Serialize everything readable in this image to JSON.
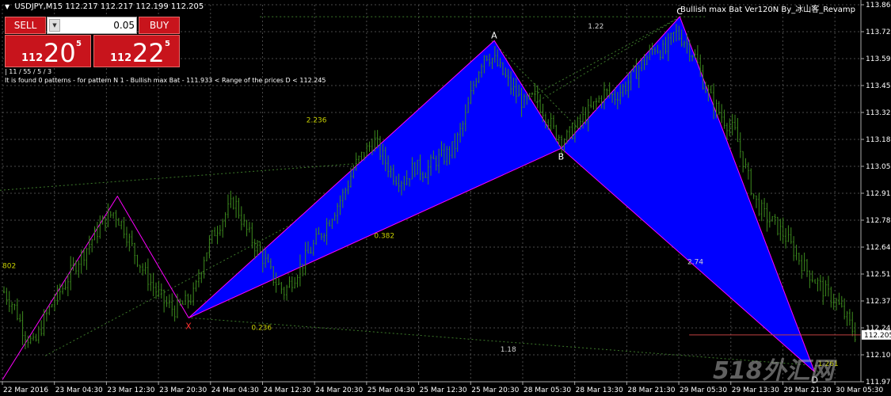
{
  "header": {
    "symbol": "USDJPY,M15",
    "ohlc": "112.217 112.217 112.199 112.205",
    "ea_title": "Bullish max Bat Ver120N By_冰山客_Revamp"
  },
  "trade_panel": {
    "sell_label": "SELL",
    "buy_label": "BUY",
    "lot_value": "0.05",
    "bid_small": "112",
    "bid_big": "20",
    "bid_sup": "5",
    "ask_small": "112",
    "ask_big": "22",
    "ask_sup": "5"
  },
  "info_lines": {
    "line1": "| 11 / 55 / 5 / 3",
    "line2": "It is found 0 patterns  -  for pattern N 1 - Bullish max Bat - 111.933 < Range of the prices D < 112.245"
  },
  "colors": {
    "background": "#000000",
    "grid": "#4a4a4a",
    "candles": "#3d8b1e",
    "pattern_fill": "#0000ff",
    "pattern_edge": "#ff00ff",
    "fib_text": "#c8d000",
    "panel_red": "#c8141c",
    "price_tag": "#ffffff"
  },
  "chart_data": {
    "type": "candlestick",
    "symbol": "USDJPY",
    "timeframe": "M15",
    "ylim": [
      111.97,
      113.86
    ],
    "y_ticks": [
      "113.860",
      "113.725",
      "113.590",
      "113.455",
      "113.320",
      "113.185",
      "113.050",
      "112.915",
      "112.780",
      "112.645",
      "112.510",
      "112.375",
      "112.240",
      "112.105",
      "111.970"
    ],
    "current_price": "112.205",
    "x_ticks": [
      "22 Mar 2016",
      "23 Mar 04:30",
      "23 Mar 12:30",
      "23 Mar 20:30",
      "24 Mar 04:30",
      "24 Mar 12:30",
      "24 Mar 20:30",
      "25 Mar 04:30",
      "25 Mar 12:30",
      "25 Mar 20:30",
      "28 Mar 05:30",
      "28 Mar 13:30",
      "28 Mar 21:30",
      "29 Mar 05:30",
      "29 Mar 13:30",
      "29 Mar 21:30",
      "30 Mar 05:30"
    ],
    "pattern_points": [
      {
        "label": "X",
        "x": 0.217,
        "price": 112.29
      },
      {
        "label": "A",
        "x": 0.573,
        "price": 113.68
      },
      {
        "label": "B",
        "x": 0.651,
        "price": 113.14
      },
      {
        "label": "C",
        "x": 0.789,
        "price": 113.8
      },
      {
        "label": "D",
        "x": 0.946,
        "price": 112.02
      }
    ],
    "ratio_labels": [
      {
        "text": "1.22",
        "x": 0.682,
        "price": 113.74
      },
      {
        "text": "2.236",
        "x": 0.354,
        "price": 113.27
      },
      {
        "text": "0.382",
        "x": 0.433,
        "price": 112.69
      },
      {
        "text": "0.236",
        "x": 0.29,
        "price": 112.23
      },
      {
        "text": "2.74",
        "x": 0.798,
        "price": 112.56
      },
      {
        "text": "1.18",
        "x": 0.58,
        "price": 112.12
      },
      {
        "text": "1.261",
        "x": 0.95,
        "price": 112.05
      },
      {
        "text": "802",
        "x": 0.0,
        "price": 112.54
      }
    ],
    "series": [
      {
        "name": "close",
        "values": [
          112.42,
          112.35,
          112.22,
          112.15,
          112.28,
          112.38,
          112.45,
          112.55,
          112.62,
          112.7,
          112.78,
          112.82,
          112.74,
          112.62,
          112.52,
          112.44,
          112.37,
          112.33,
          112.36,
          112.41,
          112.6,
          112.72,
          112.8,
          112.88,
          112.75,
          112.66,
          112.58,
          112.48,
          112.42,
          112.5,
          112.58,
          112.66,
          112.74,
          112.83,
          112.92,
          113.05,
          113.12,
          113.18,
          113.08,
          113.0,
          112.98,
          113.05,
          113.02,
          113.08,
          113.1,
          113.15,
          113.28,
          113.48,
          113.62,
          113.58,
          113.5,
          113.42,
          113.36,
          113.4,
          113.32,
          113.22,
          113.18,
          113.24,
          113.3,
          113.36,
          113.42,
          113.4,
          113.45,
          113.52,
          113.58,
          113.65,
          113.62,
          113.72,
          113.68,
          113.6,
          113.45,
          113.35,
          113.28,
          113.22,
          113.05,
          112.88,
          112.8,
          112.76,
          112.7,
          112.62,
          112.54,
          112.48,
          112.42,
          112.38,
          112.3,
          112.21
        ]
      }
    ]
  },
  "watermark": "518外汇网"
}
